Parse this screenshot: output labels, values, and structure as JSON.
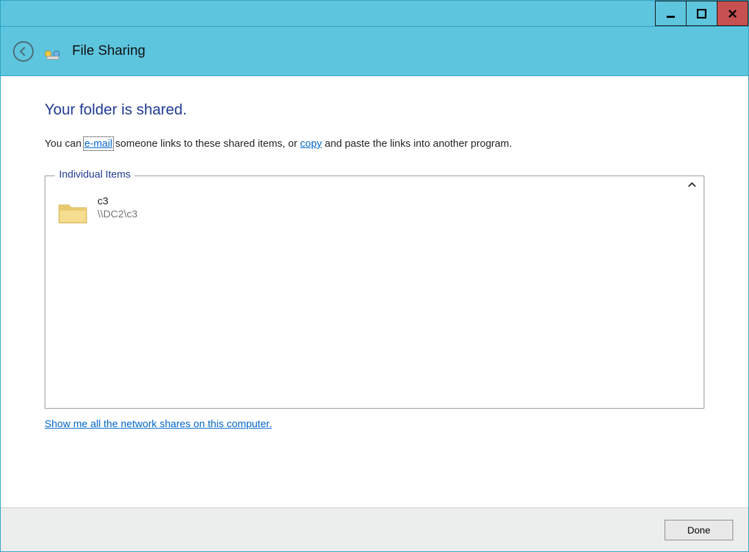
{
  "window": {
    "title": "File Sharing"
  },
  "main": {
    "heading": "Your folder is shared.",
    "instruction_prefix": "You can ",
    "email_link": "e-mail",
    "instruction_middle": " someone links to these shared items, or ",
    "copy_link": "copy",
    "instruction_suffix": " and paste the links into another program."
  },
  "group": {
    "title": "Individual Items",
    "collapse_glyph": "⌃",
    "items": [
      {
        "name": "c3",
        "path": "\\\\DC2\\c3"
      }
    ]
  },
  "footer": {
    "all_shares_link": "Show me all the network shares on this computer."
  },
  "buttons": {
    "done": "Done"
  }
}
